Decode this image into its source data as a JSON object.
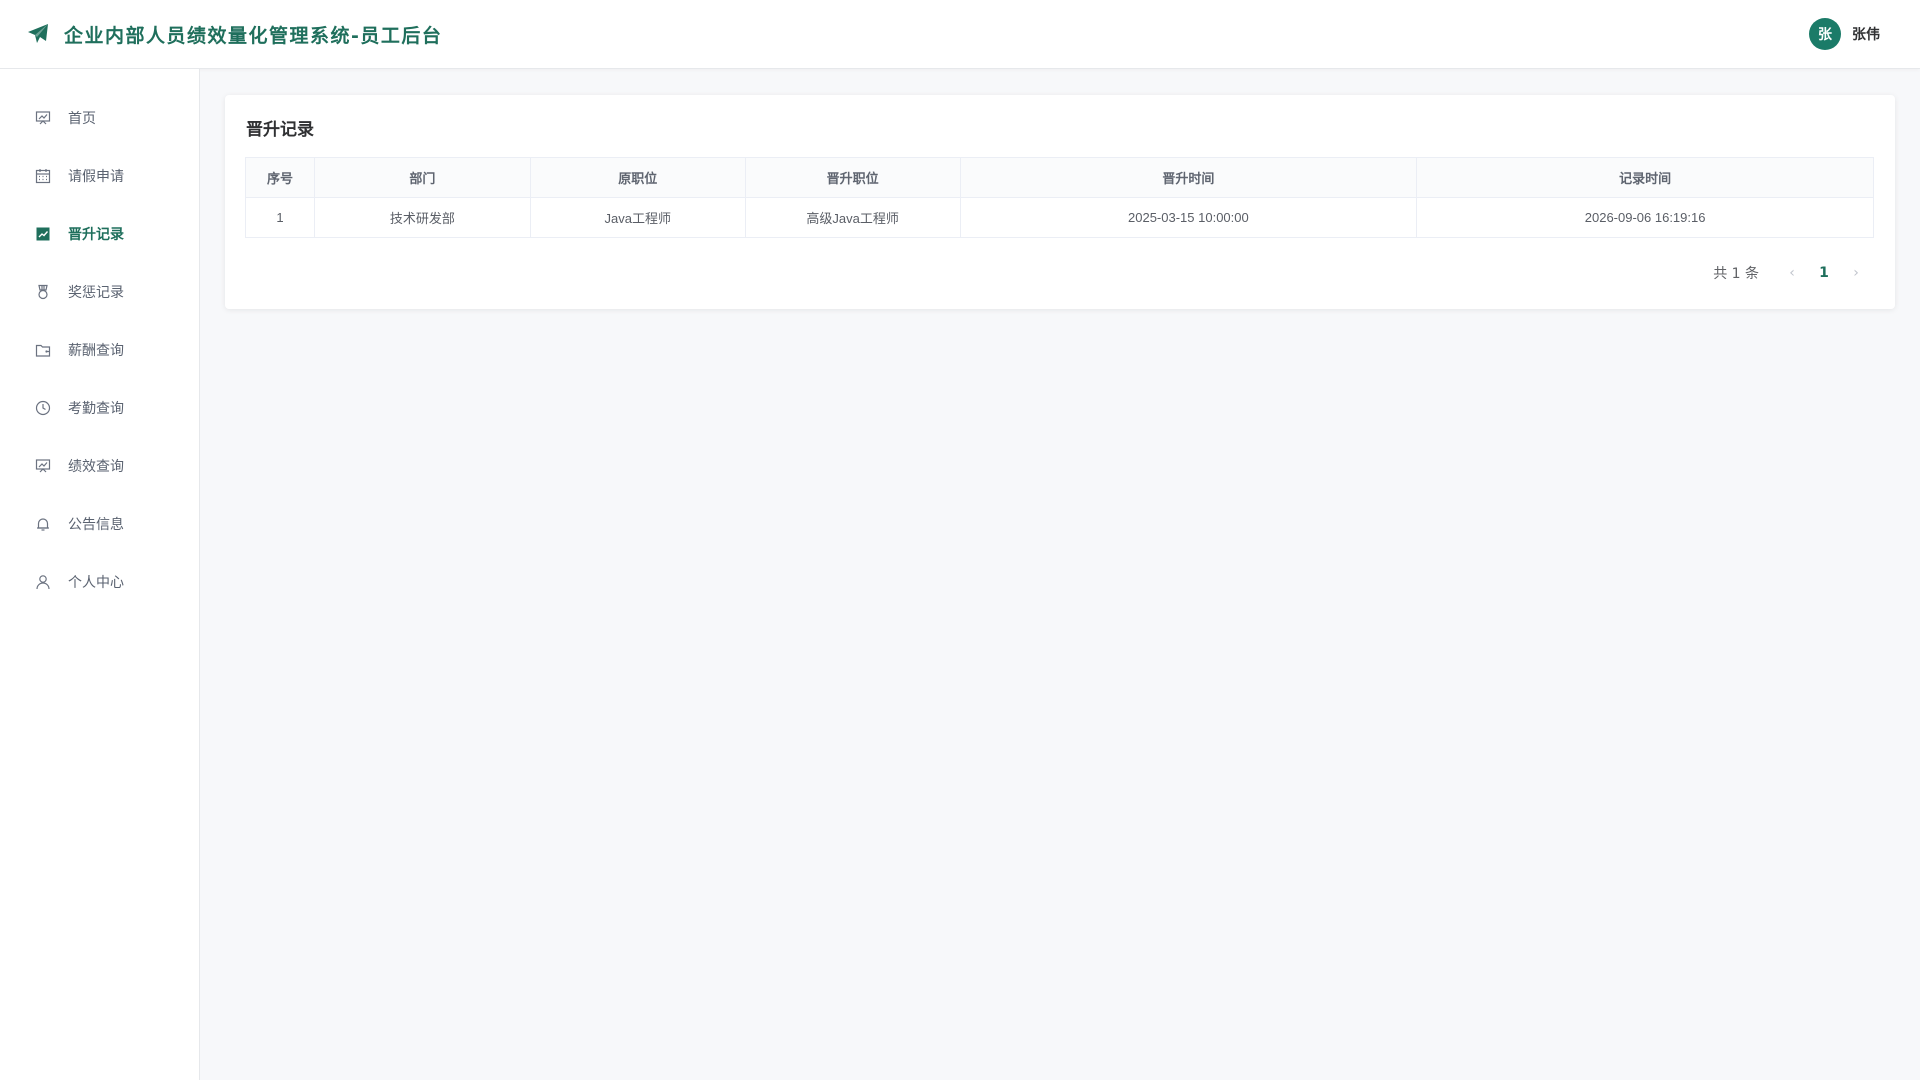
{
  "header": {
    "title": "企业内部人员绩效量化管理系统-员工后台",
    "brand_icon": "paper-plane-icon",
    "user": {
      "avatar_text": "张",
      "name": "张伟"
    }
  },
  "sidebar": {
    "items": [
      {
        "label": "首页",
        "icon": "presentation-icon",
        "active": false
      },
      {
        "label": "请假申请",
        "icon": "calendar-icon",
        "active": false
      },
      {
        "label": "晋升记录",
        "icon": "trend-chart-icon",
        "active": true
      },
      {
        "label": "奖惩记录",
        "icon": "medal-icon",
        "active": false
      },
      {
        "label": "薪酬查询",
        "icon": "wallet-icon",
        "active": false
      },
      {
        "label": "考勤查询",
        "icon": "clock-icon",
        "active": false
      },
      {
        "label": "绩效查询",
        "icon": "presentation-icon",
        "active": false
      },
      {
        "label": "公告信息",
        "icon": "bell-icon",
        "active": false
      },
      {
        "label": "个人中心",
        "icon": "user-icon",
        "active": false
      }
    ]
  },
  "main": {
    "title": "晋升记录",
    "table": {
      "columns": [
        "序号",
        "部门",
        "原职位",
        "晋升职位",
        "晋升时间",
        "记录时间"
      ],
      "rows": [
        [
          "1",
          "技术研发部",
          "Java工程师",
          "高级Java工程师",
          "2025-03-15 10:00:00",
          "2026-09-06 16:19:16"
        ]
      ]
    },
    "pagination": {
      "total_text": "共 1 条",
      "current_page": "1"
    }
  },
  "colors": {
    "accent": "#1f6f5c",
    "avatar_bg": "#1b7b68"
  }
}
